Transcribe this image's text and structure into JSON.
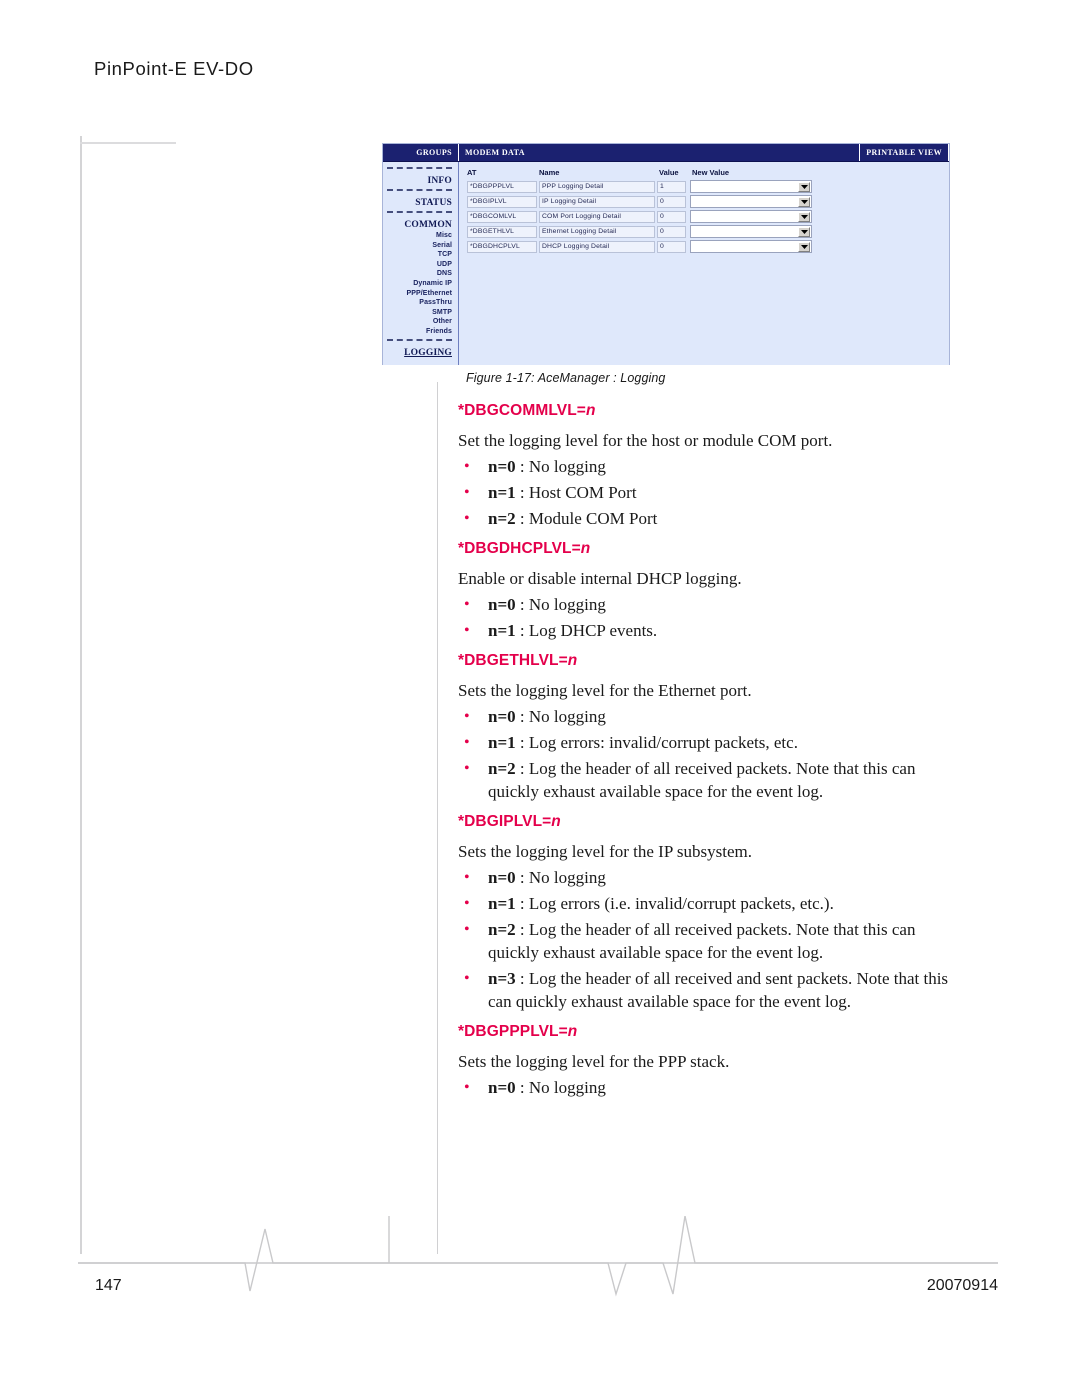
{
  "header": {
    "running_title": "PinPoint-E EV-DO"
  },
  "figure": {
    "caption": "Figure 1-17: AceManager : Logging",
    "topbar": {
      "groups_label": "GROUPS",
      "title": "MODEM DATA",
      "printable_view": "PRINTABLE VIEW"
    },
    "sidebar": {
      "items": [
        {
          "label": "INFO",
          "type": "major",
          "underline": false
        },
        {
          "label": "STATUS",
          "type": "major",
          "underline": false
        },
        {
          "label": "COMMON",
          "type": "major",
          "underline": false
        },
        {
          "label": "Misc",
          "type": "minor"
        },
        {
          "label": "Serial",
          "type": "minor"
        },
        {
          "label": "TCP",
          "type": "minor"
        },
        {
          "label": "UDP",
          "type": "minor"
        },
        {
          "label": "DNS",
          "type": "minor"
        },
        {
          "label": "Dynamic IP",
          "type": "minor"
        },
        {
          "label": "PPP/Ethernet",
          "type": "minor"
        },
        {
          "label": "PassThru",
          "type": "minor"
        },
        {
          "label": "SMTP",
          "type": "minor"
        },
        {
          "label": "Other",
          "type": "minor"
        },
        {
          "label": "Friends",
          "type": "minor"
        },
        {
          "label": "LOGGING",
          "type": "major",
          "underline": true
        }
      ]
    },
    "table": {
      "columns": [
        "AT",
        "Name",
        "Value",
        "New Value"
      ],
      "rows": [
        {
          "at": "*DBGPPPLVL",
          "name": "PPP Logging Detail",
          "value": "1",
          "new_value": ""
        },
        {
          "at": "*DBGIPLVL",
          "name": "IP Logging Detail",
          "value": "0",
          "new_value": ""
        },
        {
          "at": "*DBGCOMLVL",
          "name": "COM Port Logging Detail",
          "value": "0",
          "new_value": ""
        },
        {
          "at": "*DBGETHLVL",
          "name": "Ethernet Logging Detail",
          "value": "0",
          "new_value": ""
        },
        {
          "at": "*DBGDHCPLVL",
          "name": "DHCP Logging Detail",
          "value": "0",
          "new_value": ""
        }
      ]
    }
  },
  "commands": [
    {
      "name": "*DBGCOMMLVL=",
      "var": "n",
      "description": "Set the logging level for the host or module COM port.",
      "options": [
        {
          "key": "n=0",
          "text": " : No logging"
        },
        {
          "key": "n=1",
          "text": " : Host COM Port"
        },
        {
          "key": "n=2",
          "text": " : Module COM Port"
        }
      ]
    },
    {
      "name": "*DBGDHCPLVL=",
      "var": "n",
      "description": "Enable or disable internal DHCP logging.",
      "options": [
        {
          "key": "n=0",
          "text": " : No logging"
        },
        {
          "key": "n=1",
          "text": " : Log DHCP events."
        }
      ]
    },
    {
      "name": "*DBGETHLVL=",
      "var": "n",
      "description": "Sets the logging level for the Ethernet port.",
      "options": [
        {
          "key": "n=0",
          "text": " : No logging"
        },
        {
          "key": "n=1",
          "text": " : Log errors: invalid/corrupt packets, etc."
        },
        {
          "key": "n=2",
          "text": " : Log the header of all received packets. Note that this can quickly exhaust available space for the event log."
        }
      ]
    },
    {
      "name": "*DBGIPLVL=",
      "var": "n",
      "description": "Sets the logging level for the IP subsystem.",
      "options": [
        {
          "key": "n=0",
          "text": " : No logging"
        },
        {
          "key": "n=1",
          "text": " : Log errors (i.e. invalid/corrupt packets, etc.)."
        },
        {
          "key": "n=2",
          "text": " : Log the header of all received packets. Note that this can quickly exhaust available space for the event log."
        },
        {
          "key": "n=3",
          "text": " : Log the header of all received and sent packets. Note that this can quickly exhaust available space for the event log."
        }
      ]
    },
    {
      "name": "*DBGPPPLVL=",
      "var": "n",
      "description": "Sets the logging level for the PPP stack.",
      "options": [
        {
          "key": "n=0",
          "text": " : No logging"
        }
      ]
    }
  ],
  "footer": {
    "page_number": "147",
    "date": "20070914"
  },
  "colors": {
    "accent_red": "#e4004b",
    "navy": "#1b2170",
    "panel_blue": "#dfe8fb"
  }
}
